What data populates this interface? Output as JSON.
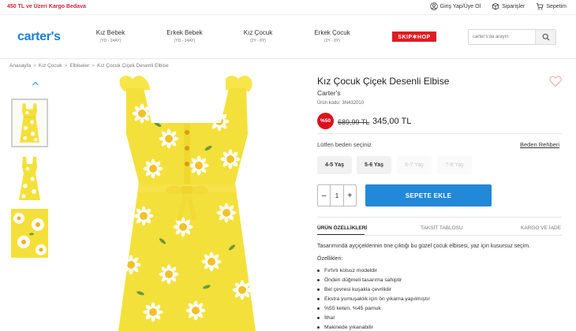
{
  "topbar": {
    "promo": "450 TL ve Üzeri Kargo Bedava",
    "links": [
      {
        "label": "Giriş Yap/Üye Ol",
        "icon": "user-icon"
      },
      {
        "label": "Siparişler",
        "icon": "package-icon"
      },
      {
        "label": "Sepetim",
        "icon": "cart-icon"
      }
    ]
  },
  "header": {
    "logo": "carter's",
    "nav": [
      {
        "title": "Kız Bebek",
        "sub": "(YD - 24AY)"
      },
      {
        "title": "Erkek Bebek",
        "sub": "(YD - 24AY)"
      },
      {
        "title": "Kız Çocuk",
        "sub": "(2Y - 8Y)"
      },
      {
        "title": "Erkek Çocuk",
        "sub": "(2Y - 8Y)"
      }
    ],
    "partner_logo": "SKIP✱HOP",
    "search": {
      "placeholder": "carter's'da arayın"
    }
  },
  "breadcrumb": [
    "Anasayfa",
    "Kız Çocuk",
    "Elbiseler",
    "Kız Çocuk Çiçek Desenli Elbise"
  ],
  "product": {
    "title": "Kız Çocuk Çiçek Desenli Elbise",
    "brand": "Carter's",
    "code_label": "Ürün kodu:",
    "code": "3N432010",
    "discount_badge": "%50",
    "old_price": "689,99 TL",
    "new_price": "345,00 TL",
    "size_label": "Lütfen beden seçiniz",
    "size_guide": "Beden Rehberi",
    "sizes": [
      {
        "label": "4-5 Yaş",
        "available": true
      },
      {
        "label": "5-6 Yaş",
        "available": true
      },
      {
        "label": "6-7 Yaş",
        "available": false
      },
      {
        "label": "7-8 Yaş",
        "available": false
      }
    ],
    "quantity": {
      "minus": "–",
      "value": "1",
      "plus": "+"
    },
    "add_to_cart": "SEPETE EKLE",
    "tabs": [
      "ÜRÜN ÖZELLİKLERİ",
      "TAKSİT TABLOSU",
      "KARGO VE İADE"
    ],
    "description": "Tasarımında ayçiçeklerinin öne çıktığı bu güzel çocuk elbisesi, yaz için kusursuz seçim.",
    "features_label": "Özellikleri:",
    "features": [
      "Fırfırlı kolsuz modeldir",
      "Önden düğmeli tasarıma sahiptir",
      "Bel çevresi kuşakla çevrilidir",
      "Ekstra yumuşaklık için ön yıkama yapılmıştır",
      "%55 keten, %45 pamuk",
      "İthal",
      "Makinede yıkanabilir"
    ]
  },
  "colors": {
    "brand_blue": "#1b7fd0",
    "cta_blue": "#2288d8",
    "promo_red": "#d0263a",
    "discount_red": "#d9121f",
    "dress_yellow": "#f4e03a"
  }
}
